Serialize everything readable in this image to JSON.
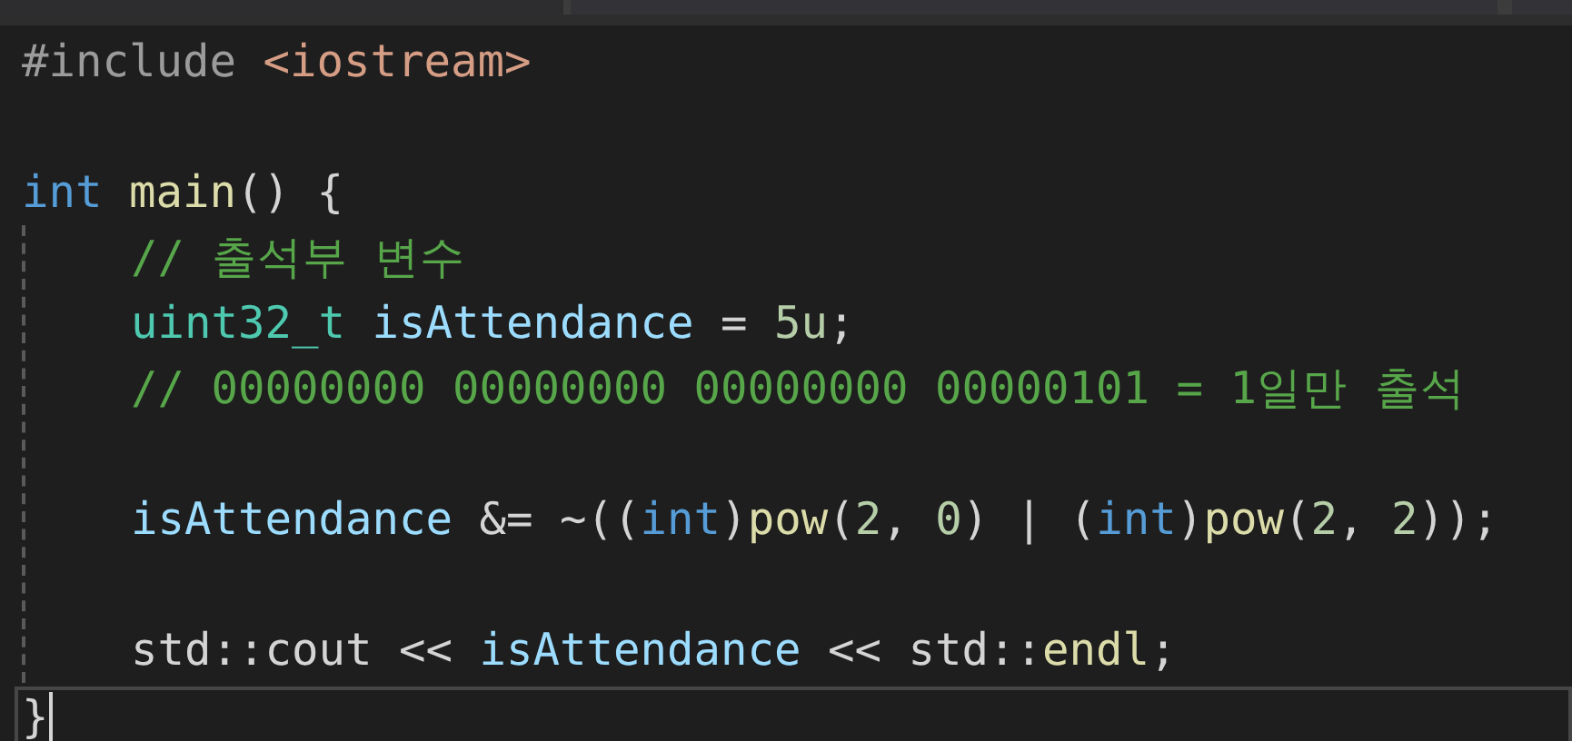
{
  "editor": {
    "lines": [
      {
        "current": false,
        "tokens": [
          {
            "kind": "preprocessor",
            "text": "#include "
          },
          {
            "kind": "string",
            "text": "<iostream>"
          }
        ]
      },
      {
        "current": false
      },
      {
        "current": false,
        "tokens": [
          {
            "kind": "keyword",
            "text": "int "
          },
          {
            "kind": "function",
            "text": "main"
          },
          {
            "kind": "plain",
            "text": "() {"
          }
        ],
        "children": [
          {
            "kind": "code",
            "tokens": [
              {
                "kind": "comment",
                "text": "// 출석부 변수"
              }
            ]
          },
          {
            "kind": "code",
            "tokens": [
              {
                "kind": "type",
                "text": "uint32_t "
              },
              {
                "kind": "variable",
                "text": "isAttendance"
              },
              {
                "kind": "plain",
                "text": " = "
              },
              {
                "kind": "number",
                "text": "5u"
              },
              {
                "kind": "plain",
                "text": ";"
              }
            ]
          },
          {
            "kind": "code",
            "tokens": [
              {
                "kind": "comment",
                "text": "// 00000000 00000000 00000000 00000101 = 1일만 출석"
              }
            ]
          },
          {
            "kind": "blank"
          },
          {
            "kind": "code",
            "tokens": [
              {
                "kind": "variable",
                "text": "isAttendance"
              },
              {
                "kind": "plain",
                "text": " &= ~(("
              },
              {
                "kind": "keyword",
                "text": "int"
              },
              {
                "kind": "plain",
                "text": ")"
              },
              {
                "kind": "function",
                "text": "pow"
              },
              {
                "kind": "plain",
                "text": "("
              },
              {
                "kind": "number",
                "text": "2"
              },
              {
                "kind": "plain",
                "text": ", "
              },
              {
                "kind": "number",
                "text": "0"
              },
              {
                "kind": "plain",
                "text": ") | ("
              },
              {
                "kind": "keyword",
                "text": "int"
              },
              {
                "kind": "plain",
                "text": ")"
              },
              {
                "kind": "function",
                "text": "pow"
              },
              {
                "kind": "plain",
                "text": "("
              },
              {
                "kind": "number",
                "text": "2"
              },
              {
                "kind": "plain",
                "text": ", "
              },
              {
                "kind": "number",
                "text": "2"
              },
              {
                "kind": "plain",
                "text": "));"
              }
            ]
          },
          {
            "kind": "blank"
          },
          {
            "kind": "code",
            "tokens": [
              {
                "kind": "plain",
                "text": "std::cout << "
              },
              {
                "kind": "variable",
                "text": "isAttendance"
              },
              {
                "kind": "plain",
                "text": " << std::"
              },
              {
                "kind": "function",
                "text": "endl"
              },
              {
                "kind": "plain",
                "text": ";"
              }
            ]
          }
        ]
      },
      {
        "current": true,
        "tokens": [
          {
            "kind": "plain",
            "text": "}"
          }
        ]
      }
    ]
  }
}
